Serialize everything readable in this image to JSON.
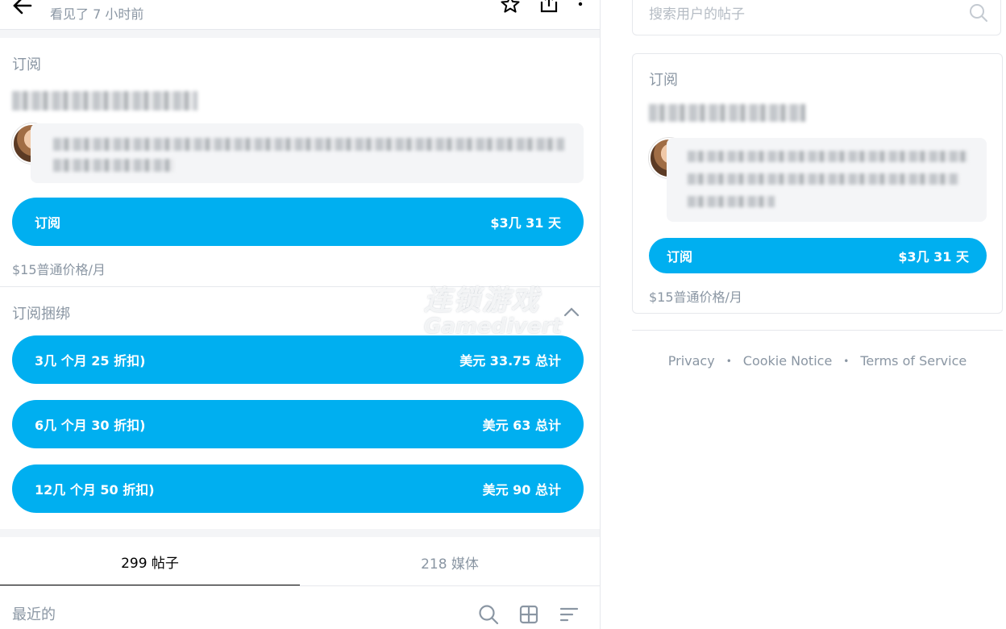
{
  "header": {
    "seen_text": "看见了  7 小时前"
  },
  "subscription": {
    "label": "订阅",
    "button_label": "订阅",
    "button_price": "$3几 31 天",
    "regular_price": "$15普通价格/月"
  },
  "bundles": {
    "label": "订阅捆绑",
    "items": [
      {
        "label": "3几 个月 25 折扣)",
        "total": "美元 33.75 总计"
      },
      {
        "label": "6几 个月 30 折扣)",
        "total": "美元 63 总计"
      },
      {
        "label": "12几 个月 50 折扣)",
        "total": "美元 90 总计"
      }
    ]
  },
  "tabs": [
    {
      "label": "299 帖子",
      "active": true
    },
    {
      "label": "218 媒体",
      "active": false
    }
  ],
  "feed": {
    "recent_label": "最近的"
  },
  "sidebar": {
    "search": {
      "placeholder": "搜索用户的帖子"
    },
    "card": {
      "label": "订阅",
      "button_label": "订阅",
      "button_price": "$3几 31 天",
      "regular_price": "$15普通价格/月"
    },
    "footer": [
      "Privacy",
      "Cookie Notice",
      "Terms of Service"
    ]
  },
  "watermark": {
    "line1": "连锁游戏",
    "line2": "Gamedivert"
  },
  "colors": {
    "accent": "#00aff0",
    "muted_text": "#8a96a3",
    "divider": "#e6e8ec"
  }
}
